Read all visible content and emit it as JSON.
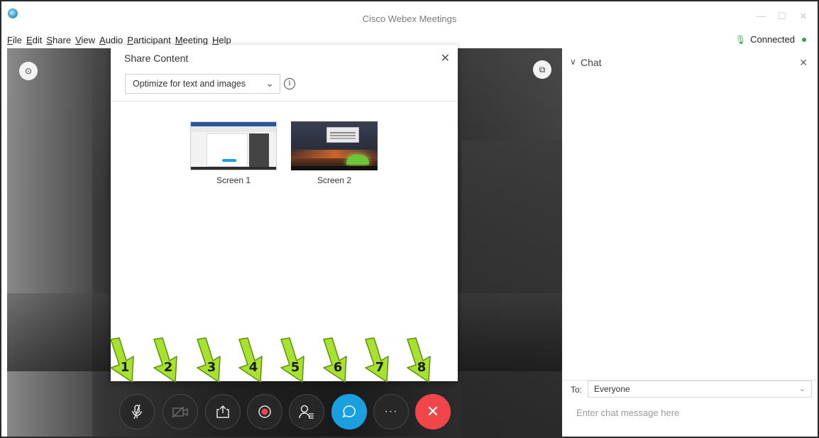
{
  "window": {
    "title": "Cisco Webex Meetings",
    "controls": [
      "—",
      "☐",
      "✕"
    ]
  },
  "menu": {
    "items": [
      "File",
      "Edit",
      "Share",
      "View",
      "Audio",
      "Participant",
      "Meeting",
      "Help"
    ],
    "connection_status": "Connected",
    "connection_color": "#2ea84e"
  },
  "share_dialog": {
    "title": "Share Content",
    "close_glyph": "✕",
    "optimize_value": "Optimize for text and images",
    "info_glyph": "i",
    "screens": [
      {
        "label": "Screen 1"
      },
      {
        "label": "Screen 2"
      }
    ]
  },
  "controls": {
    "buttons": [
      {
        "name": "mute-button",
        "icon": "mic-off-icon",
        "glyph": "🎙"
      },
      {
        "name": "video-button",
        "icon": "video-off-icon",
        "glyph": "▭"
      },
      {
        "name": "share-button",
        "icon": "share-icon",
        "glyph": "⇧"
      },
      {
        "name": "record-button",
        "icon": "record-icon",
        "glyph": "◉"
      },
      {
        "name": "participants-button",
        "icon": "participants-icon",
        "glyph": "👤"
      },
      {
        "name": "chat-button",
        "icon": "chat-icon",
        "glyph": "💬"
      },
      {
        "name": "more-button",
        "icon": "more-icon",
        "glyph": "···"
      },
      {
        "name": "leave-button",
        "icon": "close-icon",
        "glyph": "✕"
      }
    ],
    "chat_color": "#1aa0e0",
    "leave_color": "#f0454a"
  },
  "annotations": {
    "numbers": [
      "1",
      "2",
      "3",
      "4",
      "5",
      "6",
      "7",
      "8"
    ],
    "arrow_color": "#a6e22e"
  },
  "chat": {
    "title": "Chat",
    "to_label": "To:",
    "to_value": "Everyone",
    "placeholder": "Enter chat message here"
  }
}
